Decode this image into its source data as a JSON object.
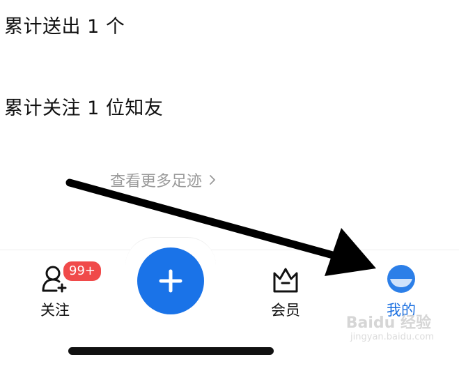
{
  "stats": {
    "sent_line": "累计送出 1 个",
    "follow_line": "累计关注 1 位知友"
  },
  "more_link": {
    "label": "查看更多足迹",
    "icon": "chevron-right-icon"
  },
  "tabbar": {
    "follow": {
      "label": "关注",
      "badge": "99+",
      "icon": "person-plus-icon"
    },
    "plus": {
      "icon": "plus-icon"
    },
    "member": {
      "label": "会员",
      "icon": "crown-bag-icon"
    },
    "mine": {
      "label": "我的",
      "icon": "avatar-icon"
    }
  },
  "watermark": {
    "logo_text": "Baidu 经验",
    "url": "jingyan.baidu.com"
  },
  "colors": {
    "accent": "#1a73e8",
    "badge": "#f04a4a",
    "active_label": "#1a6fe0",
    "muted_text": "#9a9a9a"
  }
}
